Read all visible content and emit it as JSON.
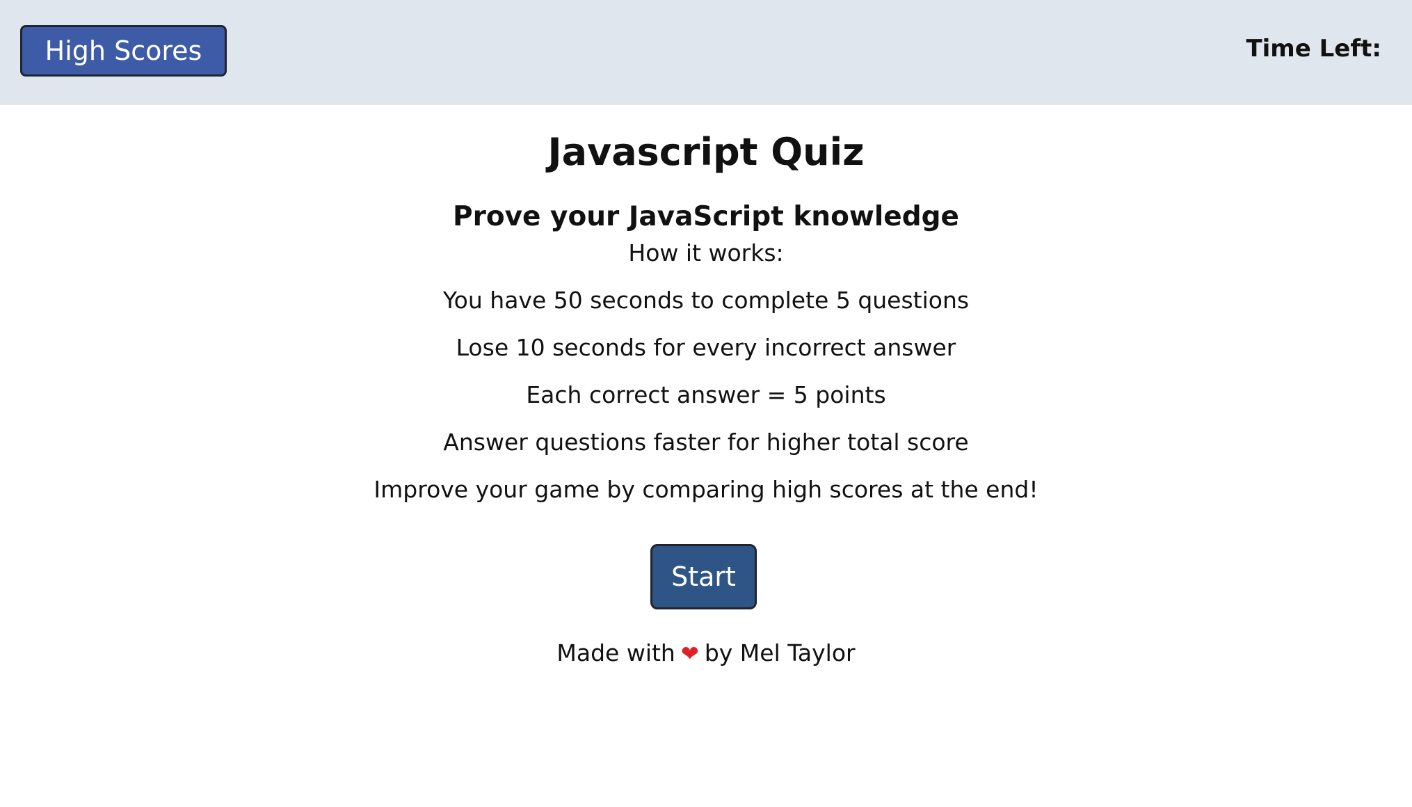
{
  "header": {
    "high_scores_label": "High Scores",
    "timer_label": "Time Left:"
  },
  "main": {
    "title": "Javascript Quiz",
    "subtitle": "Prove your JavaScript knowledge",
    "intro": "How it works:",
    "rules": [
      "You have 50 seconds to complete 5 questions",
      "Lose 10 seconds for every incorrect answer",
      "Each correct answer = 5 points",
      "Answer questions faster for higher total score",
      "Improve your game by comparing high scores at the end!"
    ],
    "start_label": "Start"
  },
  "footer": {
    "made_with": "Made with",
    "heart_icon": "heart-icon",
    "heart_glyph": "❤",
    "by": "by Mel Taylor"
  },
  "colors": {
    "topbar": "#dfe6ee",
    "high_scores_button": "#3d5ba6",
    "start_button": "#2f5586",
    "heart": "#e01f26"
  }
}
